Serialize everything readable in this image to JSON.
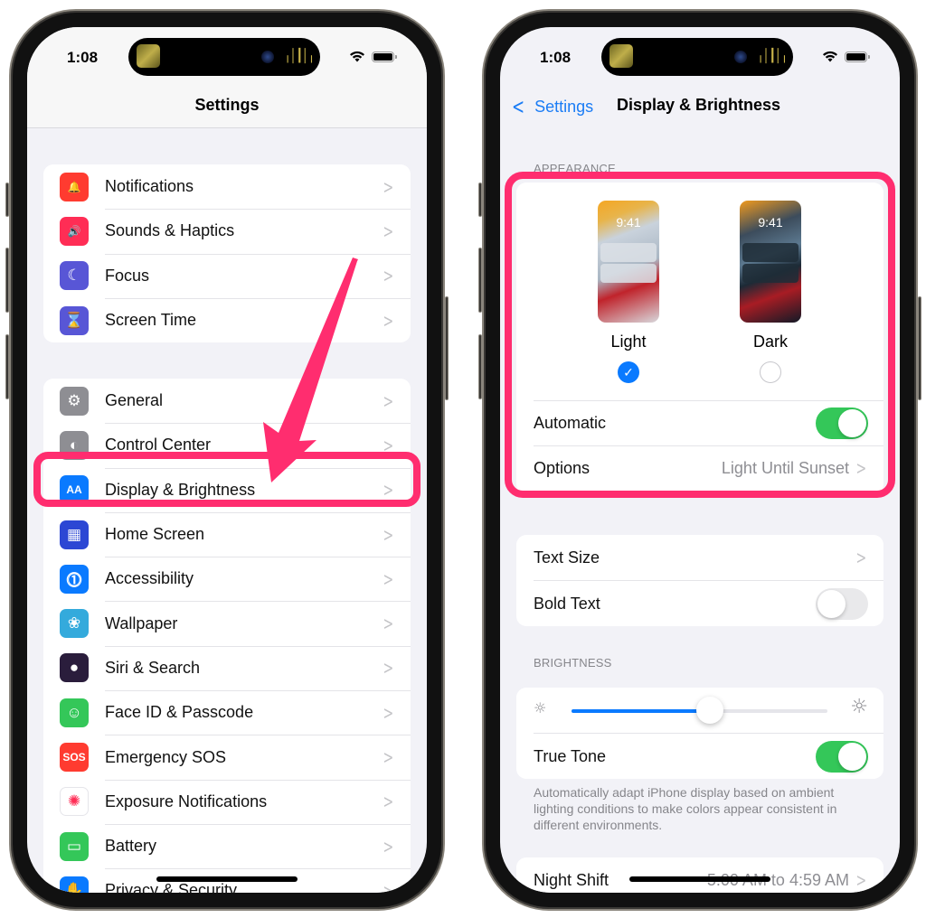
{
  "left_phone": {
    "status": {
      "time": "1:08"
    },
    "nav_title": "Settings",
    "groups": [
      {
        "items": [
          {
            "label": "Notifications",
            "icon": "notifications-icon",
            "color": "#ff3b30",
            "glyph": "🔔"
          },
          {
            "label": "Sounds & Haptics",
            "icon": "speaker-icon",
            "color": "#ff2d55",
            "glyph": "🔊"
          },
          {
            "label": "Focus",
            "icon": "moon-icon",
            "color": "#5856d6",
            "glyph": "☾"
          },
          {
            "label": "Screen Time",
            "icon": "hourglass-icon",
            "color": "#5856d6",
            "glyph": "⌛"
          }
        ]
      },
      {
        "items": [
          {
            "label": "General",
            "icon": "gear-icon",
            "color": "#8e8e93",
            "glyph": "⚙"
          },
          {
            "label": "Control Center",
            "icon": "toggles-icon",
            "color": "#8e8e93",
            "glyph": "◐"
          },
          {
            "label": "Display & Brightness",
            "icon": "text-size-icon",
            "color": "#0a7aff",
            "glyph": "AA"
          },
          {
            "label": "Home Screen",
            "icon": "app-grid-icon",
            "color": "#2c47d4",
            "glyph": "▦"
          },
          {
            "label": "Accessibility",
            "icon": "accessibility-icon",
            "color": "#0a7aff",
            "glyph": "⓵"
          },
          {
            "label": "Wallpaper",
            "icon": "flower-icon",
            "color": "#34aadc",
            "glyph": "❀"
          },
          {
            "label": "Siri & Search",
            "icon": "siri-icon",
            "color": "#2a1d3c",
            "glyph": "●"
          },
          {
            "label": "Face ID & Passcode",
            "icon": "face-id-icon",
            "color": "#34c759",
            "glyph": "☺"
          },
          {
            "label": "Emergency SOS",
            "icon": "sos-icon",
            "color": "#ff3b30",
            "glyph": "SOS"
          },
          {
            "label": "Exposure Notifications",
            "icon": "exposure-icon",
            "color": "#ffffff",
            "glyph": "✺"
          },
          {
            "label": "Battery",
            "icon": "battery-icon",
            "color": "#34c759",
            "glyph": "▭"
          },
          {
            "label": "Privacy & Security",
            "icon": "hand-icon",
            "color": "#0a7aff",
            "glyph": "✋"
          }
        ]
      }
    ],
    "highlighted_item": "Display & Brightness"
  },
  "right_phone": {
    "status": {
      "time": "1:08"
    },
    "back_label": "Settings",
    "nav_title": "Display & Brightness",
    "appearance": {
      "header": "APPEARANCE",
      "modes": [
        {
          "label": "Light",
          "preview_time": "9:41",
          "selected": true
        },
        {
          "label": "Dark",
          "preview_time": "9:41",
          "selected": false
        }
      ],
      "automatic_label": "Automatic",
      "automatic_on": true,
      "options_label": "Options",
      "options_value": "Light Until Sunset"
    },
    "text": {
      "text_size_label": "Text Size",
      "bold_text_label": "Bold Text",
      "bold_text_on": false
    },
    "brightness": {
      "header": "BRIGHTNESS",
      "level": 0.54,
      "true_tone_label": "True Tone",
      "true_tone_on": true,
      "footer": "Automatically adapt iPhone display based on ambient lighting conditions to make colors appear consistent in different environments."
    },
    "night_shift": {
      "label": "Night Shift",
      "value": "5:00 AM to 4:59 AM"
    }
  },
  "annotation_color": "#ff2d6f"
}
